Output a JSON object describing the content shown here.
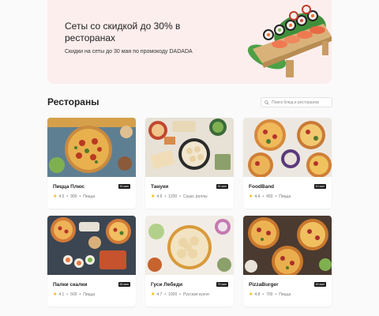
{
  "banner": {
    "title": "Сеты со скидкой до 30% в ресторанах",
    "subtitle": "Скидки на сеты до 30 мая по промокоду DADADA"
  },
  "section": {
    "title": "Рестораны"
  },
  "search": {
    "placeholder": "Поиск блюд и ресторанов"
  },
  "restaurants": [
    {
      "name": "Пицца Плюс",
      "time": "30 мин",
      "rating": "4.5",
      "price": "900",
      "cuisine": "Пицца"
    },
    {
      "name": "Тануки",
      "time": "30 мин",
      "rating": "4.9",
      "price": "1200",
      "cuisine": "Суши, роллы"
    },
    {
      "name": "FoodBand",
      "time": "40 мин",
      "rating": "4.4",
      "price": "450",
      "cuisine": "Пицца"
    },
    {
      "name": "Палки скалки",
      "time": "55 мин",
      "rating": "4.1",
      "price": "500",
      "cuisine": "Пицца"
    },
    {
      "name": "Гуси Лебеди",
      "time": "75 мин",
      "rating": "4.7",
      "price": "1000",
      "cuisine": "Русская кухня"
    },
    {
      "name": "PizzaBurger",
      "time": "45 мин",
      "rating": "4.8",
      "price": "700",
      "cuisine": "Пицца"
    }
  ],
  "colors": {
    "banner_bg": "#fdeeee",
    "badge_bg": "#1d1d1d",
    "star": "#f5b400"
  }
}
